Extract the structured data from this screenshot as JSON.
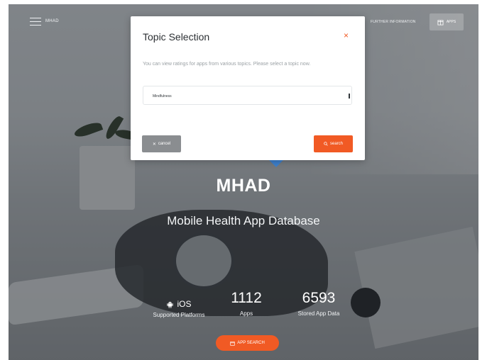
{
  "nav": {
    "brand": "MHAD",
    "further_info": "FURTHER INFORMATION",
    "apps_label": "APPS"
  },
  "hero": {
    "title": "MHAD",
    "subtitle": "Mobile Health App Database"
  },
  "stats": {
    "platform_label": "iOS",
    "platforms_caption": "Supported Platforms",
    "apps_count": "1112",
    "apps_caption": "Apps",
    "stored_count": "6593",
    "stored_caption": "Stored App Data"
  },
  "app_search_label": "APP SEARCH",
  "modal": {
    "title": "Topic Selection",
    "close_glyph": "×",
    "description": "You can view ratings for apps from various topics. Please select a topic now.",
    "select_value": "Mindfulness",
    "cancel_label": "cancel",
    "search_label": "search",
    "cancel_glyph": "✕"
  },
  "colors": {
    "accent": "#f15a24",
    "cancel_gray": "#8a8d90"
  },
  "icons": [
    "menu-icon",
    "box-icon",
    "android-icon",
    "close-icon",
    "search-icon",
    "x-icon"
  ]
}
